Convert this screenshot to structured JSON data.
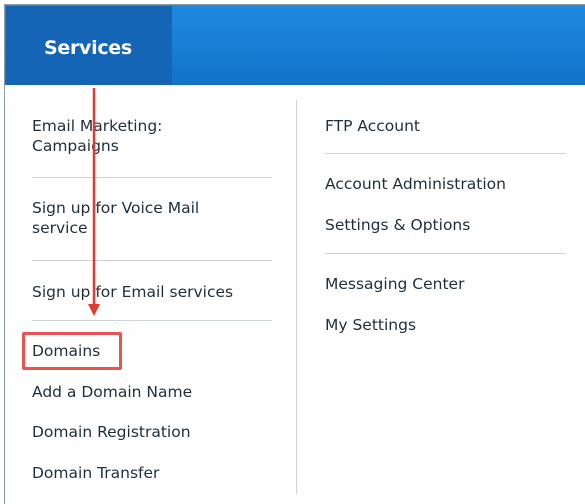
{
  "header": {
    "tab_label": "Services"
  },
  "left_column": {
    "groups": [
      [
        {
          "label": "Email Marketing:\nCampaigns"
        }
      ],
      [
        {
          "label": "Sign up for Voice Mail\nservice"
        }
      ],
      [
        {
          "label": "Sign up for Email services"
        }
      ],
      [
        {
          "label": "Domains"
        },
        {
          "label": "Add a Domain Name"
        },
        {
          "label": "Domain Registration"
        },
        {
          "label": "Domain Transfer"
        }
      ]
    ]
  },
  "right_column": {
    "groups": [
      [
        {
          "label": "FTP Account"
        }
      ],
      [
        {
          "label": "Account Administration"
        },
        {
          "label": "Settings & Options"
        }
      ],
      [
        {
          "label": "Messaging Center"
        },
        {
          "label": "My Settings"
        }
      ]
    ]
  },
  "annotation": {
    "highlight_color": "#e8534f",
    "arrow_color": "#e03a35"
  }
}
